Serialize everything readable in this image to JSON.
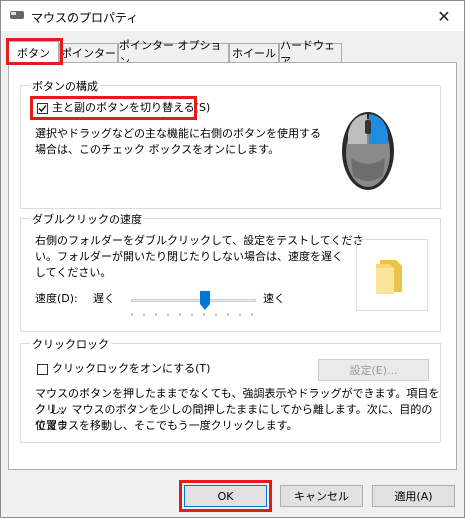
{
  "window": {
    "title": "マウスのプロパティ",
    "close_glyph": "✕"
  },
  "tabs": [
    "ボタン",
    "ポインター",
    "ポインター オプション",
    "ホイール",
    "ハードウェア"
  ],
  "button_config": {
    "title": "ボタンの構成",
    "switch_label": "主と副のボタンを切り替える(S)",
    "switch_checked": true,
    "description_line1": "選択やドラッグなどの主な機能に右側のボタンを使用する",
    "description_line2": "場合は、このチェック ボックスをオンにします。"
  },
  "double_click": {
    "title": "ダブルクリックの速度",
    "description_line1": "右側のフォルダーをダブルクリックして、設定をテストしてくださ",
    "description_line2": "い。フォルダーが開いたり閉じたりしない場合は、速度を遅く",
    "description_line3": "してください。",
    "speed_label": "速度(D):",
    "slow_label": "遅く",
    "fast_label": "速く",
    "speed_level": 0.6
  },
  "click_lock": {
    "title": "クリックロック",
    "checkbox_label": "クリックロックをオンにする(T)",
    "checked": false,
    "settings_button": "設定(E)...",
    "description_line1": "マウスのボタンを押したままでなくても、強調表示やドラッグができます。項目をクリッ",
    "description_line2": "ク し、マウスのボタンを少しの間押したままにしてから離します。次に、目的の位置ま",
    "description_line3": "でマウスを移動し、そこでもう一度クリックします。"
  },
  "footer": {
    "ok": "OK",
    "cancel": "キャンセル",
    "apply": "適用(A)"
  },
  "colors": {
    "highlight": "#e21b1b",
    "mouse_button": "#1e8de0"
  }
}
